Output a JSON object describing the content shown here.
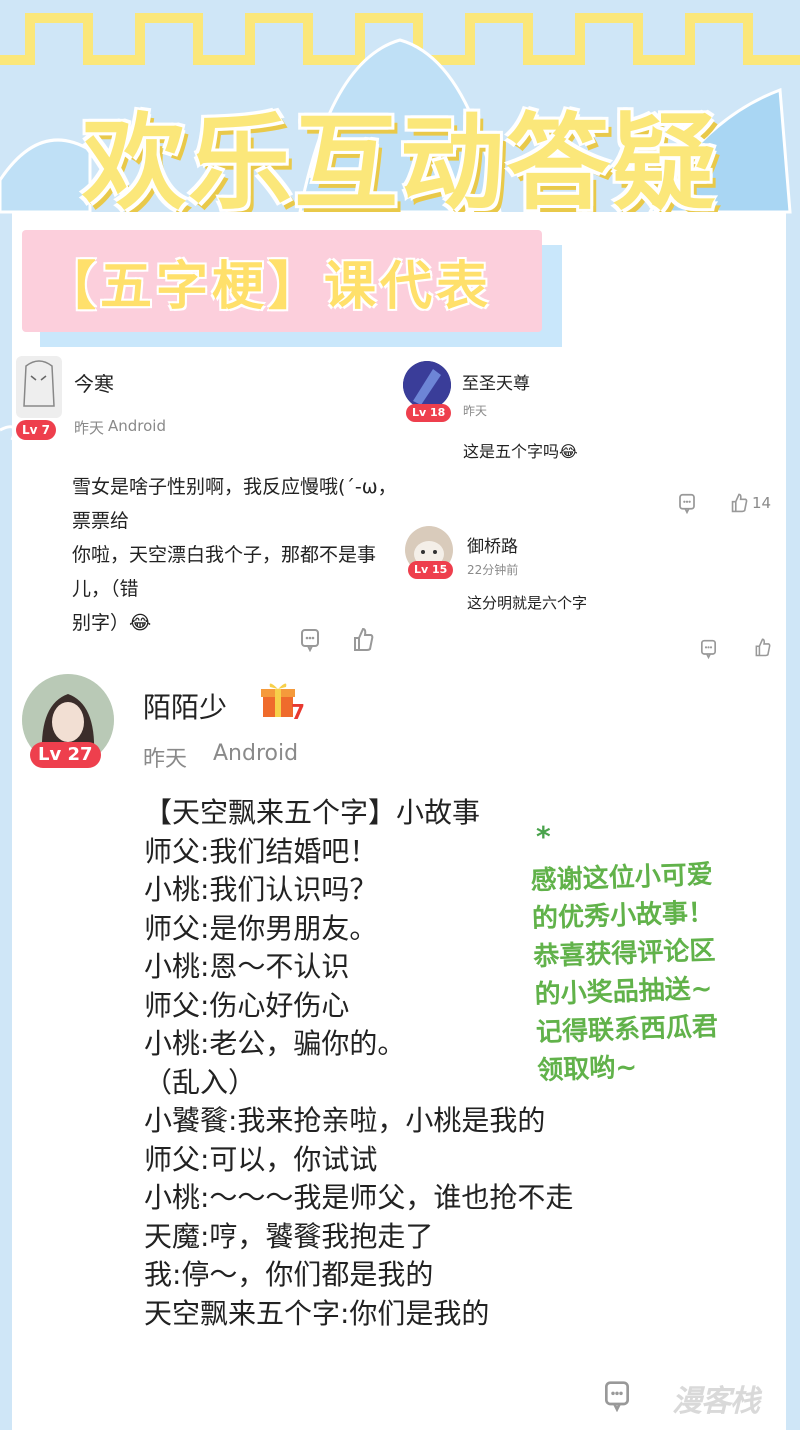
{
  "banner": {
    "title": "欢乐互动答疑"
  },
  "topic_tag": "【五字梗】课代表",
  "comments": [
    {
      "user": "今寒",
      "level": "Lv 7",
      "time": "昨天",
      "device": "Android",
      "text_lines": [
        "雪女是啥子性别啊，我反应慢哦(´-ω，票票给",
        "你啦，天空漂白我个子，那都不是事儿，（错",
        "别字）😂"
      ]
    },
    {
      "user": "至圣天尊",
      "level": "Lv 18",
      "time": "昨天",
      "text": "这是五个字吗😂",
      "likes": "14"
    },
    {
      "user": "御桥路",
      "level": "Lv 15",
      "time": "22分钟前",
      "text": "这分明就是六个字"
    },
    {
      "user": "陌陌少",
      "level": "Lv 27",
      "gift_count": "7",
      "time": "昨天",
      "device": "Android",
      "story": [
        "【天空飘来五个字】小故事",
        "师父:我们结婚吧！",
        "小桃:我们认识吗？",
        "师父:是你男朋友。",
        "小桃:恩～不认识",
        "师父:伤心好伤心",
        "小桃:老公，骗你的。",
        "（乱入）",
        "小饕餮:我来抢亲啦，小桃是我的",
        "师父:可以，你试试",
        "小桃:～～～我是师父，谁也抢不走",
        "天魔:哼，饕餮我抱走了",
        "我:停～，你们都是我的",
        "天空飘来五个字:你们是我的"
      ]
    }
  ],
  "editor_note": {
    "star": "*",
    "lines": [
      "感谢这位小可爱",
      "的优秀小故事！",
      "恭喜获得评论区",
      "的小奖品抽送~",
      "记得联系西瓜君",
      "领取哟~"
    ]
  },
  "watermark": "漫客栈",
  "colors": {
    "background": "#cfe6f7",
    "title_yellow": "#fbe77a",
    "tag_pink": "#fccfdc",
    "note_green": "#61b24a",
    "level_badge": "#ee3f4d"
  }
}
